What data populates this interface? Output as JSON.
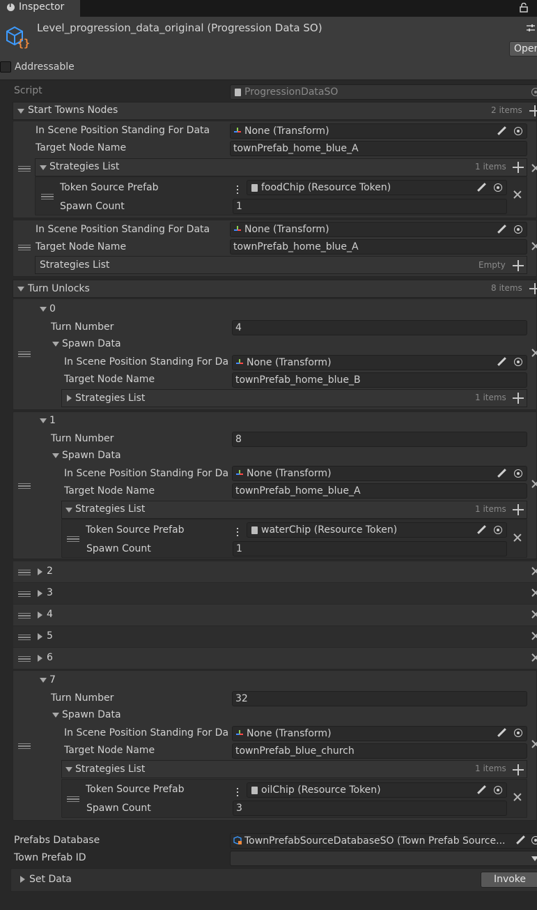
{
  "window": {
    "tab_label": "Inspector"
  },
  "header": {
    "asset_title": "Level_progression_data_original (Progression Data SO)",
    "open_button": "Oper",
    "addressable_label": "Addressable"
  },
  "script": {
    "label": "Script",
    "value": "ProgressionDataSO"
  },
  "start_towns_nodes": {
    "label": "Start Towns Nodes",
    "count": "2 items",
    "elements": [
      {
        "in_scene_label": "In Scene Position Standing For Data",
        "in_scene_value": "None (Transform)",
        "target_label": "Target Node Name",
        "target_value": "townPrefab_home_blue_A",
        "strategies_label": "Strategies List",
        "strategies_count": "1 items",
        "token_label": "Token Source Prefab",
        "token_value": "foodChip (Resource Token)",
        "spawn_label": "Spawn Count",
        "spawn_value": "1"
      },
      {
        "in_scene_label": "In Scene Position Standing For Data",
        "in_scene_value": "None (Transform)",
        "target_label": "Target Node Name",
        "target_value": "townPrefab_home_blue_A",
        "strategies_label": "Strategies List",
        "strategies_count": "Empty"
      }
    ]
  },
  "turn_unlocks": {
    "label": "Turn Unlocks",
    "count": "8 items",
    "items": [
      {
        "index": "0",
        "turn_label": "Turn Number",
        "turn_value": "4",
        "spawn_data_label": "Spawn Data",
        "in_scene_label": "In Scene Position Standing For Da",
        "in_scene_value": "None (Transform)",
        "target_label": "Target Node Name",
        "target_value": "townPrefab_home_blue_B",
        "strategies_label": "Strategies List",
        "strategies_count": "1 items"
      },
      {
        "index": "1",
        "turn_label": "Turn Number",
        "turn_value": "8",
        "spawn_data_label": "Spawn Data",
        "in_scene_label": "In Scene Position Standing For Da",
        "in_scene_value": "None (Transform)",
        "target_label": "Target Node Name",
        "target_value": "townPrefab_home_blue_A",
        "strategies_label": "Strategies List",
        "strategies_count": "1 items",
        "token_label": "Token Source Prefab",
        "token_value": "waterChip (Resource Token)",
        "spawn_label": "Spawn Count",
        "spawn_value": "1"
      },
      {
        "index": "2"
      },
      {
        "index": "3"
      },
      {
        "index": "4"
      },
      {
        "index": "5"
      },
      {
        "index": "6"
      },
      {
        "index": "7",
        "turn_label": "Turn Number",
        "turn_value": "32",
        "spawn_data_label": "Spawn Data",
        "in_scene_label": "In Scene Position Standing For Da",
        "in_scene_value": "None (Transform)",
        "target_label": "Target Node Name",
        "target_value": "townPrefab_blue_church",
        "strategies_label": "Strategies List",
        "strategies_count": "1 items",
        "token_label": "Token Source Prefab",
        "token_value": "oilChip (Resource Token)",
        "spawn_label": "Spawn Count",
        "spawn_value": "3"
      }
    ]
  },
  "footer": {
    "prefabs_db_label": "Prefabs Database",
    "prefabs_db_value": "TownPrefabSourceDatabaseSO (Town Prefab Source...",
    "town_prefab_id_label": "Town Prefab ID",
    "town_prefab_id_value": "",
    "set_data_label": "Set Data",
    "invoke_button": "Invoke"
  },
  "icons": {
    "info": "info-icon",
    "lock": "lock-icon",
    "asset": "scriptable-object-icon",
    "transform": "transform-icon",
    "script": "script-icon",
    "pencil": "pencil-icon",
    "picker": "object-picker-icon",
    "plus": "plus-icon",
    "remove": "remove-icon",
    "drag": "drag-handle-icon",
    "context": "context-menu-icon"
  },
  "colors": {
    "background": "#282828",
    "header": "#3c3c3c",
    "field": "#2a2a2a",
    "accent_blue": "#3d9bff",
    "accent_orange": "#f08a3c"
  }
}
